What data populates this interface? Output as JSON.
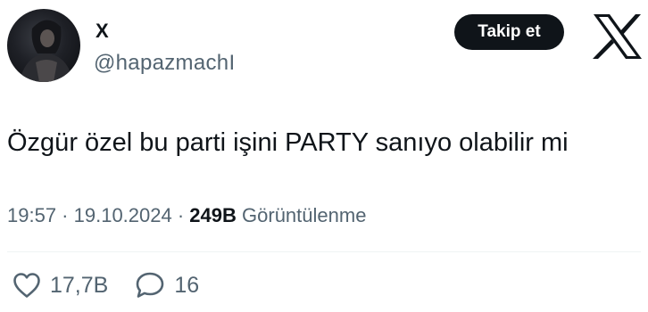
{
  "tweet": {
    "author": {
      "display_name": "X",
      "handle": "@hapazmachI"
    },
    "follow_label": "Takip et",
    "text": "Özgür özel bu parti işini PARTY sanıyo olabilir mi",
    "time": "19:57",
    "separator": " · ",
    "date": "19.10.2024",
    "views_count": "249B",
    "views_label": "Görüntülenme",
    "likes_count": "17,7B",
    "replies_count": "16"
  },
  "icons": {
    "brand": "x-logo-icon",
    "like": "heart-icon",
    "reply": "speech-bubble-icon"
  },
  "colors": {
    "text_primary": "#0f1419",
    "text_secondary": "#536471",
    "button_bg": "#0f1419",
    "button_text": "#ffffff",
    "divider": "#eff3f4"
  }
}
